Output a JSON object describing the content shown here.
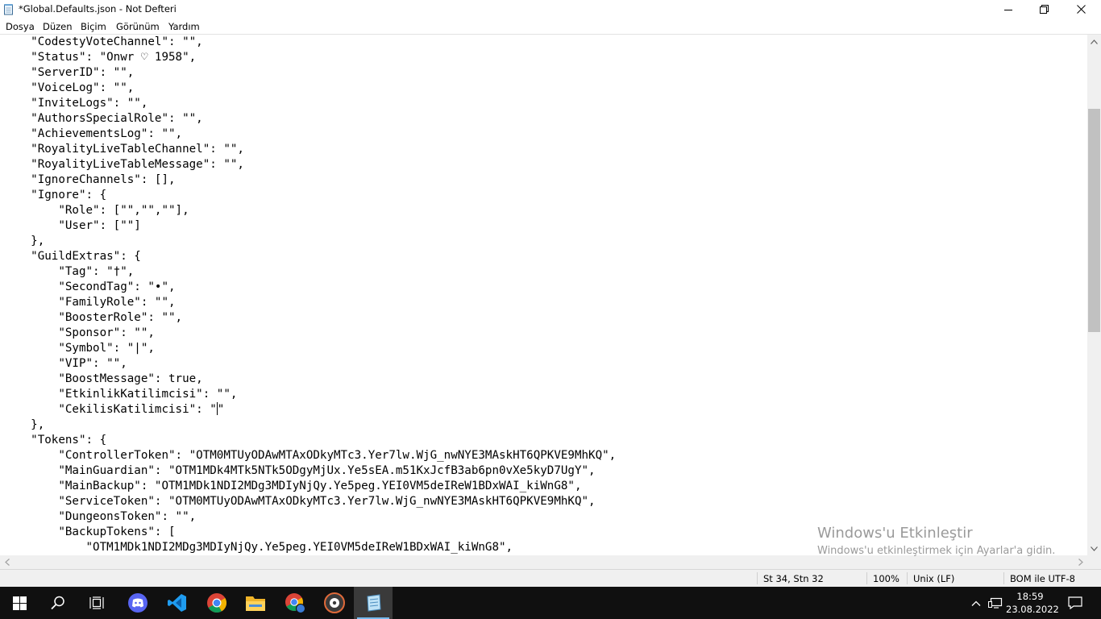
{
  "window": {
    "title": "*Global.Defaults.json - Not Defteri",
    "controls": {
      "minimize": "minimize-icon",
      "maximize": "restore-icon",
      "close": "close-icon"
    }
  },
  "menu": [
    "Dosya",
    "Düzen",
    "Biçim",
    "Görünüm",
    "Yardım"
  ],
  "editor": {
    "lines_before_caret": [
      "    \"CodestyVoteChannel\": \"\",",
      "    \"Status\": \"Onwr ♡ 1958\",",
      "    \"ServerID\": \"\",",
      "    \"VoiceLog\": \"\",",
      "    \"InviteLogs\": \"\",",
      "    \"AuthorsSpecialRole\": \"\",",
      "    \"AchievementsLog\": \"\",",
      "    \"RoyalityLiveTableChannel\": \"\",",
      "    \"RoyalityLiveTableMessage\": \"\",",
      "    \"IgnoreChannels\": [],",
      "    \"Ignore\": {",
      "        \"Role\": [\"\",\"\",\"\"],",
      "        \"User\": [\"\"]",
      "    },",
      "    \"GuildExtras\": {",
      "        \"Tag\": \"†\",",
      "        \"SecondTag\": \"•\",",
      "        \"FamilyRole\": \"\",",
      "        \"BoosterRole\": \"\",",
      "        \"Sponsor\": \"\",",
      "        \"Symbol\": \"|\",",
      "        \"VIP\": \"\",",
      "        \"BoostMessage\": true,",
      "        \"EtkinlikKatilimcisi\": \"\","
    ],
    "caret_line_before": "        \"CekilisKatilimcisi\": \"",
    "caret_line_after": "\"",
    "lines_after_caret": [
      "    },",
      "    \"Tokens\": {",
      "        \"ControllerToken\": \"OTM0MTUyODAwMTAxODkyMTc3.Yer7lw.WjG_nwNYE3MAskHT6QPKVE9MhKQ\",",
      "        \"MainGuardian\": \"OTM1MDk4MTk5NTk5ODgyMjUx.Ye5sEA.m51KxJcfB3ab6pn0vXe5kyD7UgY\",",
      "        \"MainBackup\": \"OTM1MDk1NDI2MDg3MDIyNjQy.Ye5peg.YEI0VM5deIReW1BDxWAI_kiWnG8\",",
      "        \"ServiceToken\": \"OTM0MTUyODAwMTAxODkyMTc3.Yer7lw.WjG_nwNYE3MAskHT6QPKVE9MhKQ\",",
      "        \"DungeonsToken\": \"\",",
      "        \"BackupTokens\": [",
      "            \"OTM1MDk1NDI2MDg3MDIyNjQy.Ye5peg.YEI0VM5deIReW1BDxWAI_kiWnG8\","
    ]
  },
  "status": {
    "position": "St 34, Stn 32",
    "zoom": "100%",
    "line_ending": "Unix (LF)",
    "encoding": "BOM ile UTF-8"
  },
  "watermark": {
    "line1": "Windows'u Etkinleştir",
    "line2": "Windows'u etkinleştirmek için Ayarlar'a gidin."
  },
  "taskbar": {
    "apps": [
      "start-icon",
      "search-icon",
      "task-view-icon",
      "discord-icon",
      "vscode-icon",
      "chrome-icon",
      "file-explorer-icon",
      "chrome-profile-icon",
      "media-player-icon",
      "notepad-icon"
    ],
    "active_app": "notepad-icon",
    "time": "18:59",
    "date": "23.08.2022"
  },
  "colors": {
    "taskbar_bg": "#101010",
    "scroll_thumb": "#c1c1c1",
    "active_underline": "#76b9ed"
  }
}
